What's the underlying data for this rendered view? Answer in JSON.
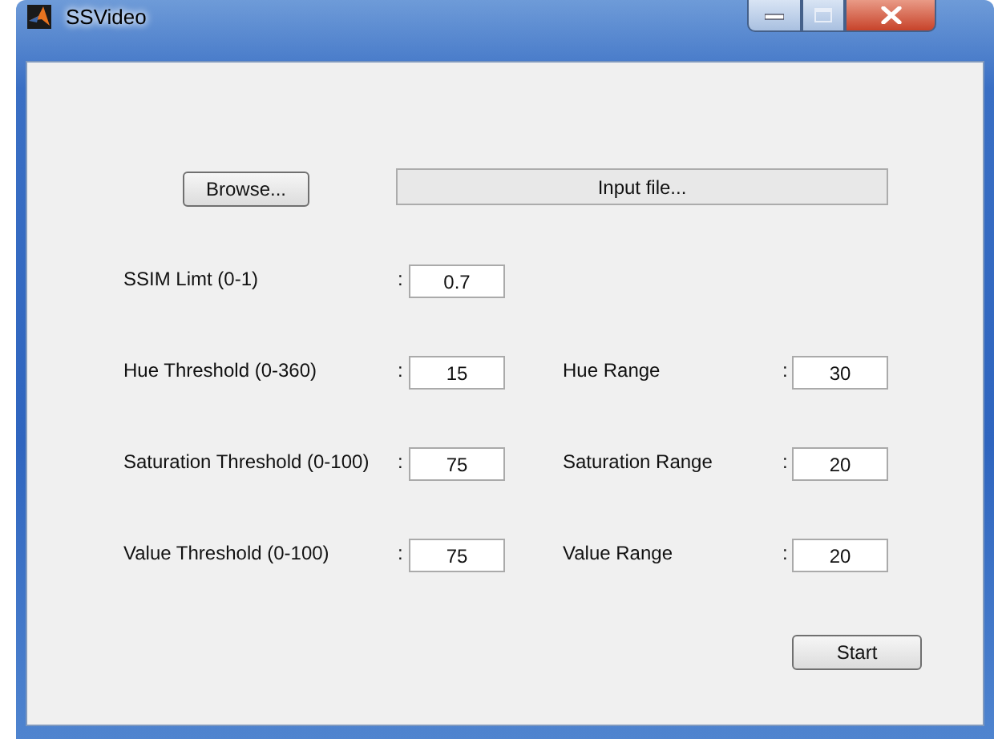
{
  "window": {
    "title": "SSVideo"
  },
  "browse_button": "Browse...",
  "file_display": "Input file...",
  "rows": [
    {
      "fields": [
        {
          "label": "SSIM Limt (0-1)",
          "separator": ":",
          "value": "0.7"
        }
      ]
    },
    {
      "fields": [
        {
          "label": "Hue Threshold (0-360)",
          "separator": ":",
          "value": "15"
        },
        {
          "label": "Hue Range",
          "separator": ":",
          "value": "30"
        }
      ]
    },
    {
      "fields": [
        {
          "label": "Saturation Threshold (0-100)",
          "separator": ":",
          "value": "75"
        },
        {
          "label": "Saturation Range",
          "separator": ":",
          "value": "20"
        }
      ]
    },
    {
      "fields": [
        {
          "label": "Value Threshold (0-100)",
          "separator": ":",
          "value": "75"
        },
        {
          "label": "Value Range",
          "separator": ":",
          "value": "20"
        }
      ]
    }
  ],
  "start_button": "Start"
}
